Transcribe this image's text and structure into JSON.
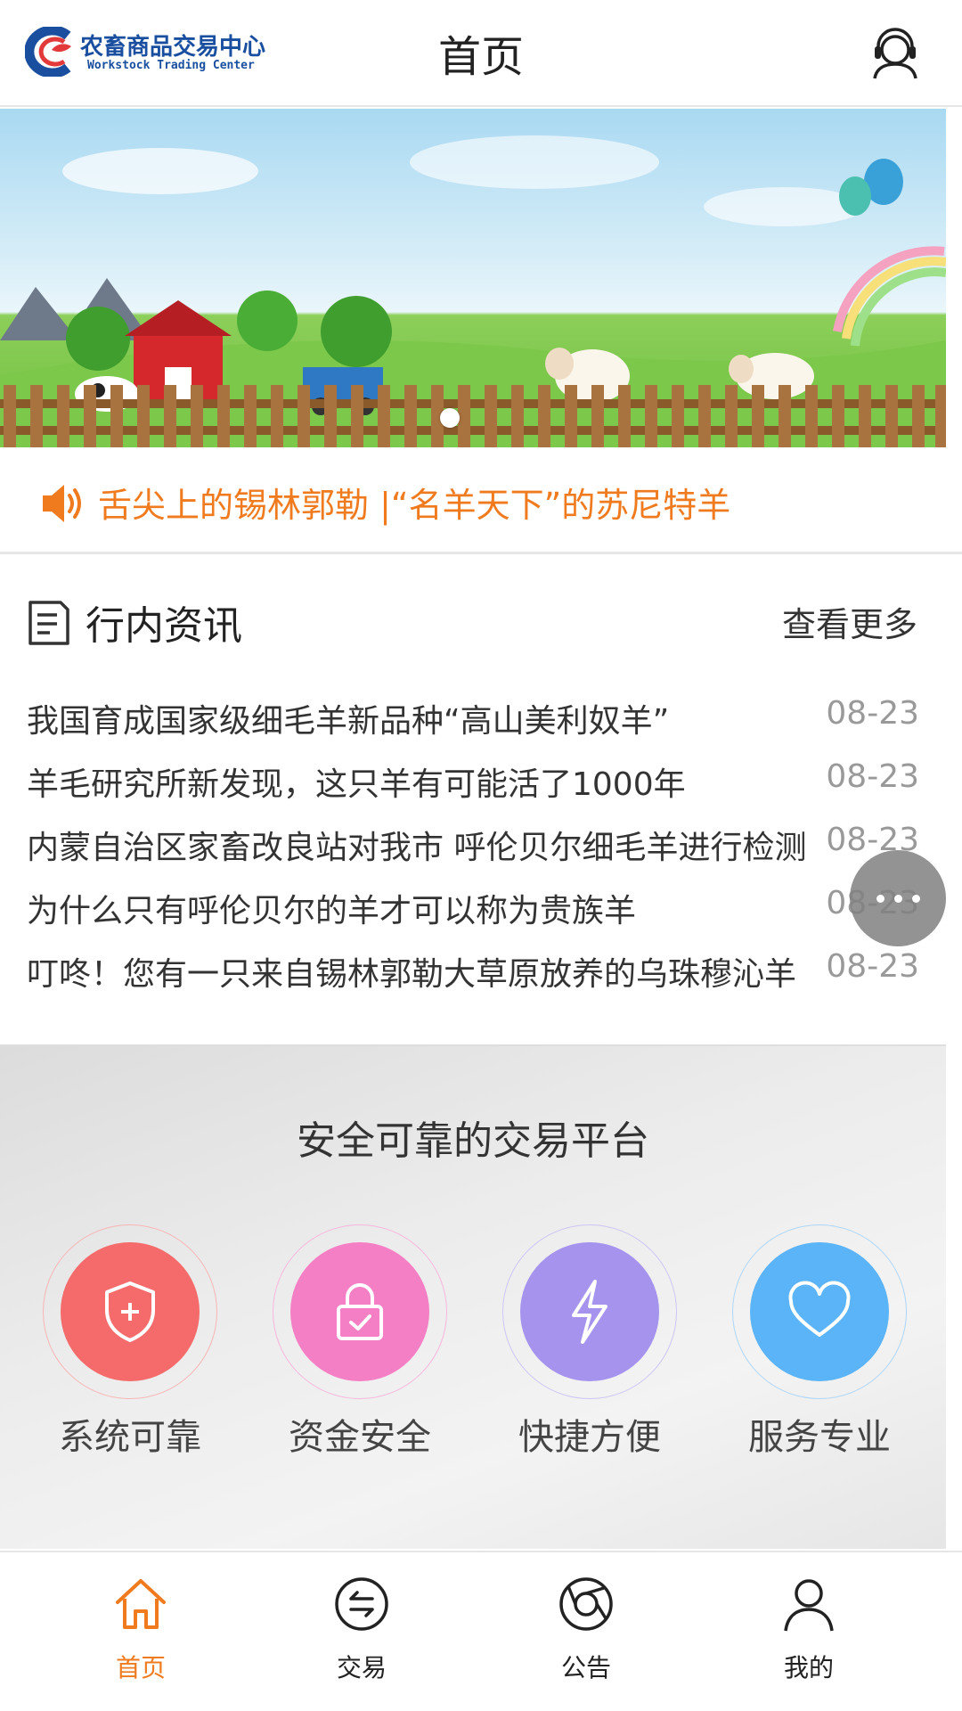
{
  "header": {
    "logo_cn": "农畜商品交易中心",
    "logo_en": "Workstock Trading Center",
    "title": "首页",
    "service_icon": "customer-service-icon"
  },
  "banner": {
    "dots": 1,
    "active_dot": 0
  },
  "notice": {
    "icon": "speaker-icon",
    "text": "舌尖上的锡林郭勒 |“名羊天下”的苏尼特羊"
  },
  "news": {
    "icon": "document-icon",
    "title": "行内资讯",
    "more": "查看更多",
    "items": [
      {
        "title": "我国育成国家级细毛羊新品种“高山美利奴羊”",
        "date": "08-23"
      },
      {
        "title": "羊毛研究所新发现，这只羊有可能活了1000年",
        "date": "08-23"
      },
      {
        "title": "内蒙自治区家畜改良站对我市 呼伦贝尔细毛羊进行检测",
        "date": "08-23"
      },
      {
        "title": "为什么只有呼伦贝尔的羊才可以称为贵族羊",
        "date": "08-23"
      },
      {
        "title": "叮咚！您有一只来自锡林郭勒大草原放养的乌珠穆沁羊",
        "date": "08-23"
      }
    ]
  },
  "features": {
    "title": "安全可靠的交易平台",
    "items": [
      {
        "label": "系统可靠",
        "icon": "shield-plus-icon",
        "color": "#f56b6b"
      },
      {
        "label": "资金安全",
        "icon": "lock-icon",
        "color": "#f57fc4"
      },
      {
        "label": "快捷方便",
        "icon": "lightning-icon",
        "color": "#a593ee"
      },
      {
        "label": "服务专业",
        "icon": "heart-icon",
        "color": "#5ab4f7"
      }
    ]
  },
  "bottom_nav": {
    "accent": "#f07a1e",
    "items": [
      {
        "label": "首页",
        "icon": "home-icon",
        "active": true
      },
      {
        "label": "交易",
        "icon": "exchange-icon",
        "active": false
      },
      {
        "label": "公告",
        "icon": "announcement-icon",
        "active": false
      },
      {
        "label": "我的",
        "icon": "user-icon",
        "active": false
      }
    ]
  }
}
